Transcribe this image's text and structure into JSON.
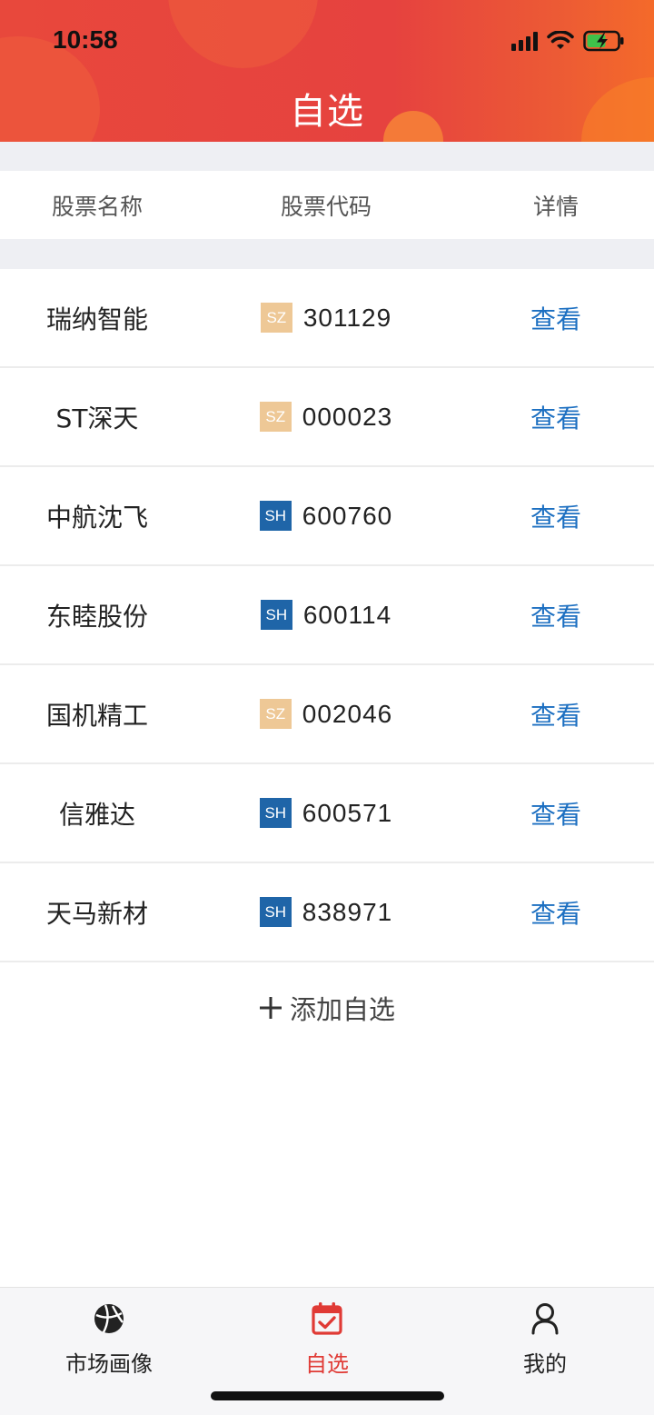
{
  "status_bar": {
    "time": "10:58"
  },
  "header": {
    "title": "自选"
  },
  "columns": {
    "name": "股票名称",
    "code": "股票代码",
    "detail": "详情"
  },
  "stocks": [
    {
      "name": "瑞纳智能",
      "market": "SZ",
      "code": "301129",
      "action": "查看"
    },
    {
      "name": "ST深天",
      "market": "SZ",
      "code": "000023",
      "action": "查看"
    },
    {
      "name": "中航沈飞",
      "market": "SH",
      "code": "600760",
      "action": "查看"
    },
    {
      "name": "东睦股份",
      "market": "SH",
      "code": "600114",
      "action": "查看"
    },
    {
      "name": "国机精工",
      "market": "SZ",
      "code": "002046",
      "action": "查看"
    },
    {
      "name": "信雅达",
      "market": "SH",
      "code": "600571",
      "action": "查看"
    },
    {
      "name": "天马新材",
      "market": "SH",
      "code": "838971",
      "action": "查看"
    }
  ],
  "add_button": {
    "icon": "plus-icon",
    "label": "添加自选"
  },
  "tabbar": {
    "items": [
      {
        "label": "市场画像",
        "icon": "basketball-icon",
        "active": false
      },
      {
        "label": "自选",
        "icon": "calendar-check-icon",
        "active": true
      },
      {
        "label": "我的",
        "icon": "user-icon",
        "active": false
      }
    ]
  },
  "colors": {
    "header_gradient_start": "#e8483c",
    "header_gradient_end": "#f46a2a",
    "sz_badge": "#eec896",
    "sh_badge": "#1f65a8",
    "link": "#1c6fc1",
    "active_tab": "#e03a35"
  }
}
